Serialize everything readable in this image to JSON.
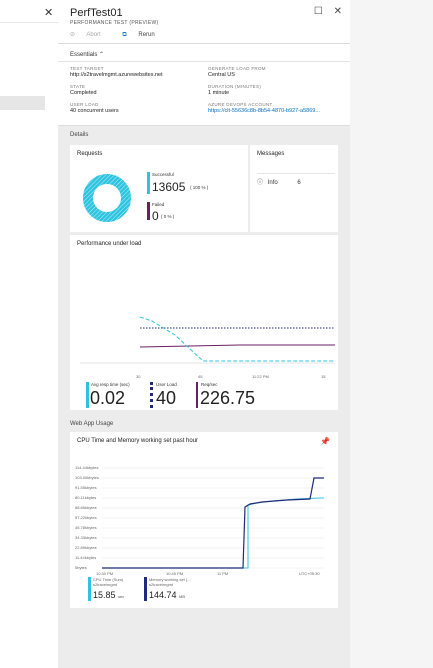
{
  "left_pane": {
    "close_glyph": "✕"
  },
  "blade": {
    "title": "PerfTest01",
    "subtitle": "PERFORMANCE TEST (PREVIEW)",
    "toolbar": {
      "abort_label": "Abort",
      "rerun_label": "Rerun"
    },
    "essentials": {
      "title": "Essentials",
      "items": [
        {
          "key": "TEST TARGET",
          "value": "http://s2travelmgmt.azurewebsites.net"
        },
        {
          "key": "GENERATE LOAD FROM",
          "value": "Central US"
        },
        {
          "key": "STATE",
          "value": "Completed"
        },
        {
          "key": "DURATION (MINUTES)",
          "value": "1 minute"
        },
        {
          "key": "USER LOAD",
          "value": "40 concurrent users"
        },
        {
          "key": "AZURE DEVOPS ACCOUNT",
          "value": "https://clt-55636c8b-8b54-4870-b927-a5869..."
        }
      ]
    },
    "details_label": "Details",
    "requests": {
      "title": "Requests",
      "successful_label": "Successful",
      "successful_value": "13605",
      "successful_pct": "( 100 % )",
      "failed_label": "Failed",
      "failed_value": "0",
      "failed_pct": "( 0 % )"
    },
    "messages": {
      "title": "Messages",
      "info_label": "Info",
      "info_count": "6"
    },
    "perf": {
      "title": "Performance under load",
      "x_ticks": [
        "30",
        "45",
        "11:22 PM",
        "15"
      ],
      "metrics": [
        {
          "label": "Avg resp time (sec)",
          "value": "0.02"
        },
        {
          "label": "User Load",
          "value": "40"
        },
        {
          "label": "Req/sec",
          "value": "226.75"
        }
      ]
    },
    "web_app_label": "Web App Usage",
    "cpu": {
      "title": "CPU Time and Memory working set past hour",
      "y_ticks": [
        "114.44kbytes",
        "103.00kbytes",
        "91.55kbytes",
        "80.11kbytes",
        "68.66kbytes",
        "57.22kbytes",
        "45.78kbytes",
        "34.33kbytes",
        "22.89kbytes",
        "11.44kbytes",
        "0bytes"
      ],
      "x_ticks": [
        "10:30 PM",
        "10:45 PM",
        "11 PM",
        "UTC+05:30"
      ],
      "legend": [
        {
          "label": "CPU Time (Sum)",
          "sub": "s2travelmgmt",
          "value": "15.85",
          "unit": "sec"
        },
        {
          "label": "Memory working set (...",
          "sub": "s2travelmgmt",
          "value": "144.74",
          "unit": "MB"
        }
      ]
    }
  },
  "colors": {
    "accent_cyan": "#2ec4e0",
    "purple": "#6b1f63",
    "navy": "#1f2a7a",
    "link": "#0072c6"
  }
}
